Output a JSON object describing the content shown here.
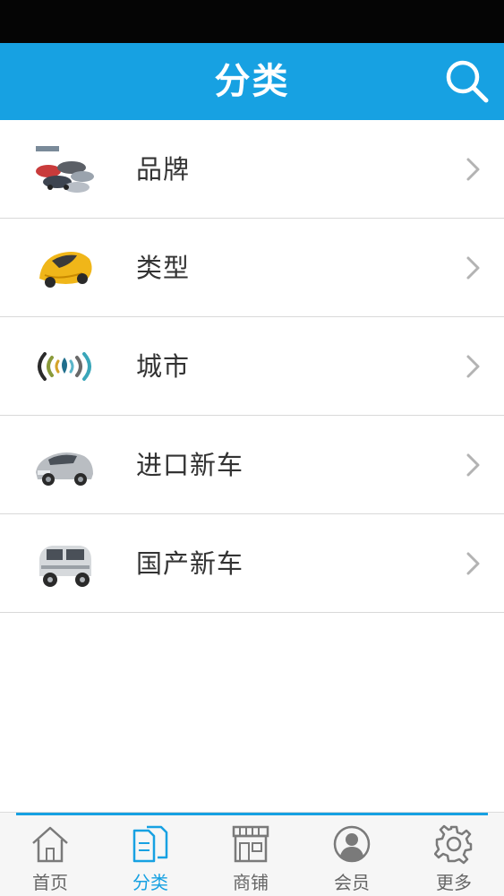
{
  "header": {
    "title": "分类",
    "search_icon": "search-icon"
  },
  "list": {
    "items": [
      {
        "label": "品牌",
        "thumb": "car-brands-photo",
        "chevron": "chevron-right-icon"
      },
      {
        "label": "类型",
        "thumb": "yellow-sports-car-photo",
        "chevron": "chevron-right-icon"
      },
      {
        "label": "城市",
        "thumb": "signal-location-graphic",
        "chevron": "chevron-right-icon"
      },
      {
        "label": "进口新车",
        "thumb": "silver-sedan-photo",
        "chevron": "chevron-right-icon"
      },
      {
        "label": "国产新车",
        "thumb": "silver-suv-photo",
        "chevron": "chevron-right-icon"
      }
    ]
  },
  "tabbar": {
    "active": "分类",
    "tabs": [
      {
        "label": "首页",
        "icon": "home-icon"
      },
      {
        "label": "分类",
        "icon": "category-icon"
      },
      {
        "label": "商铺",
        "icon": "store-icon"
      },
      {
        "label": "会员",
        "icon": "member-icon"
      },
      {
        "label": "更多",
        "icon": "gear-icon"
      }
    ]
  },
  "colors": {
    "accent": "#17a1e2",
    "status_bar": "#050505",
    "text": "#333333",
    "tab_text": "#666666"
  }
}
